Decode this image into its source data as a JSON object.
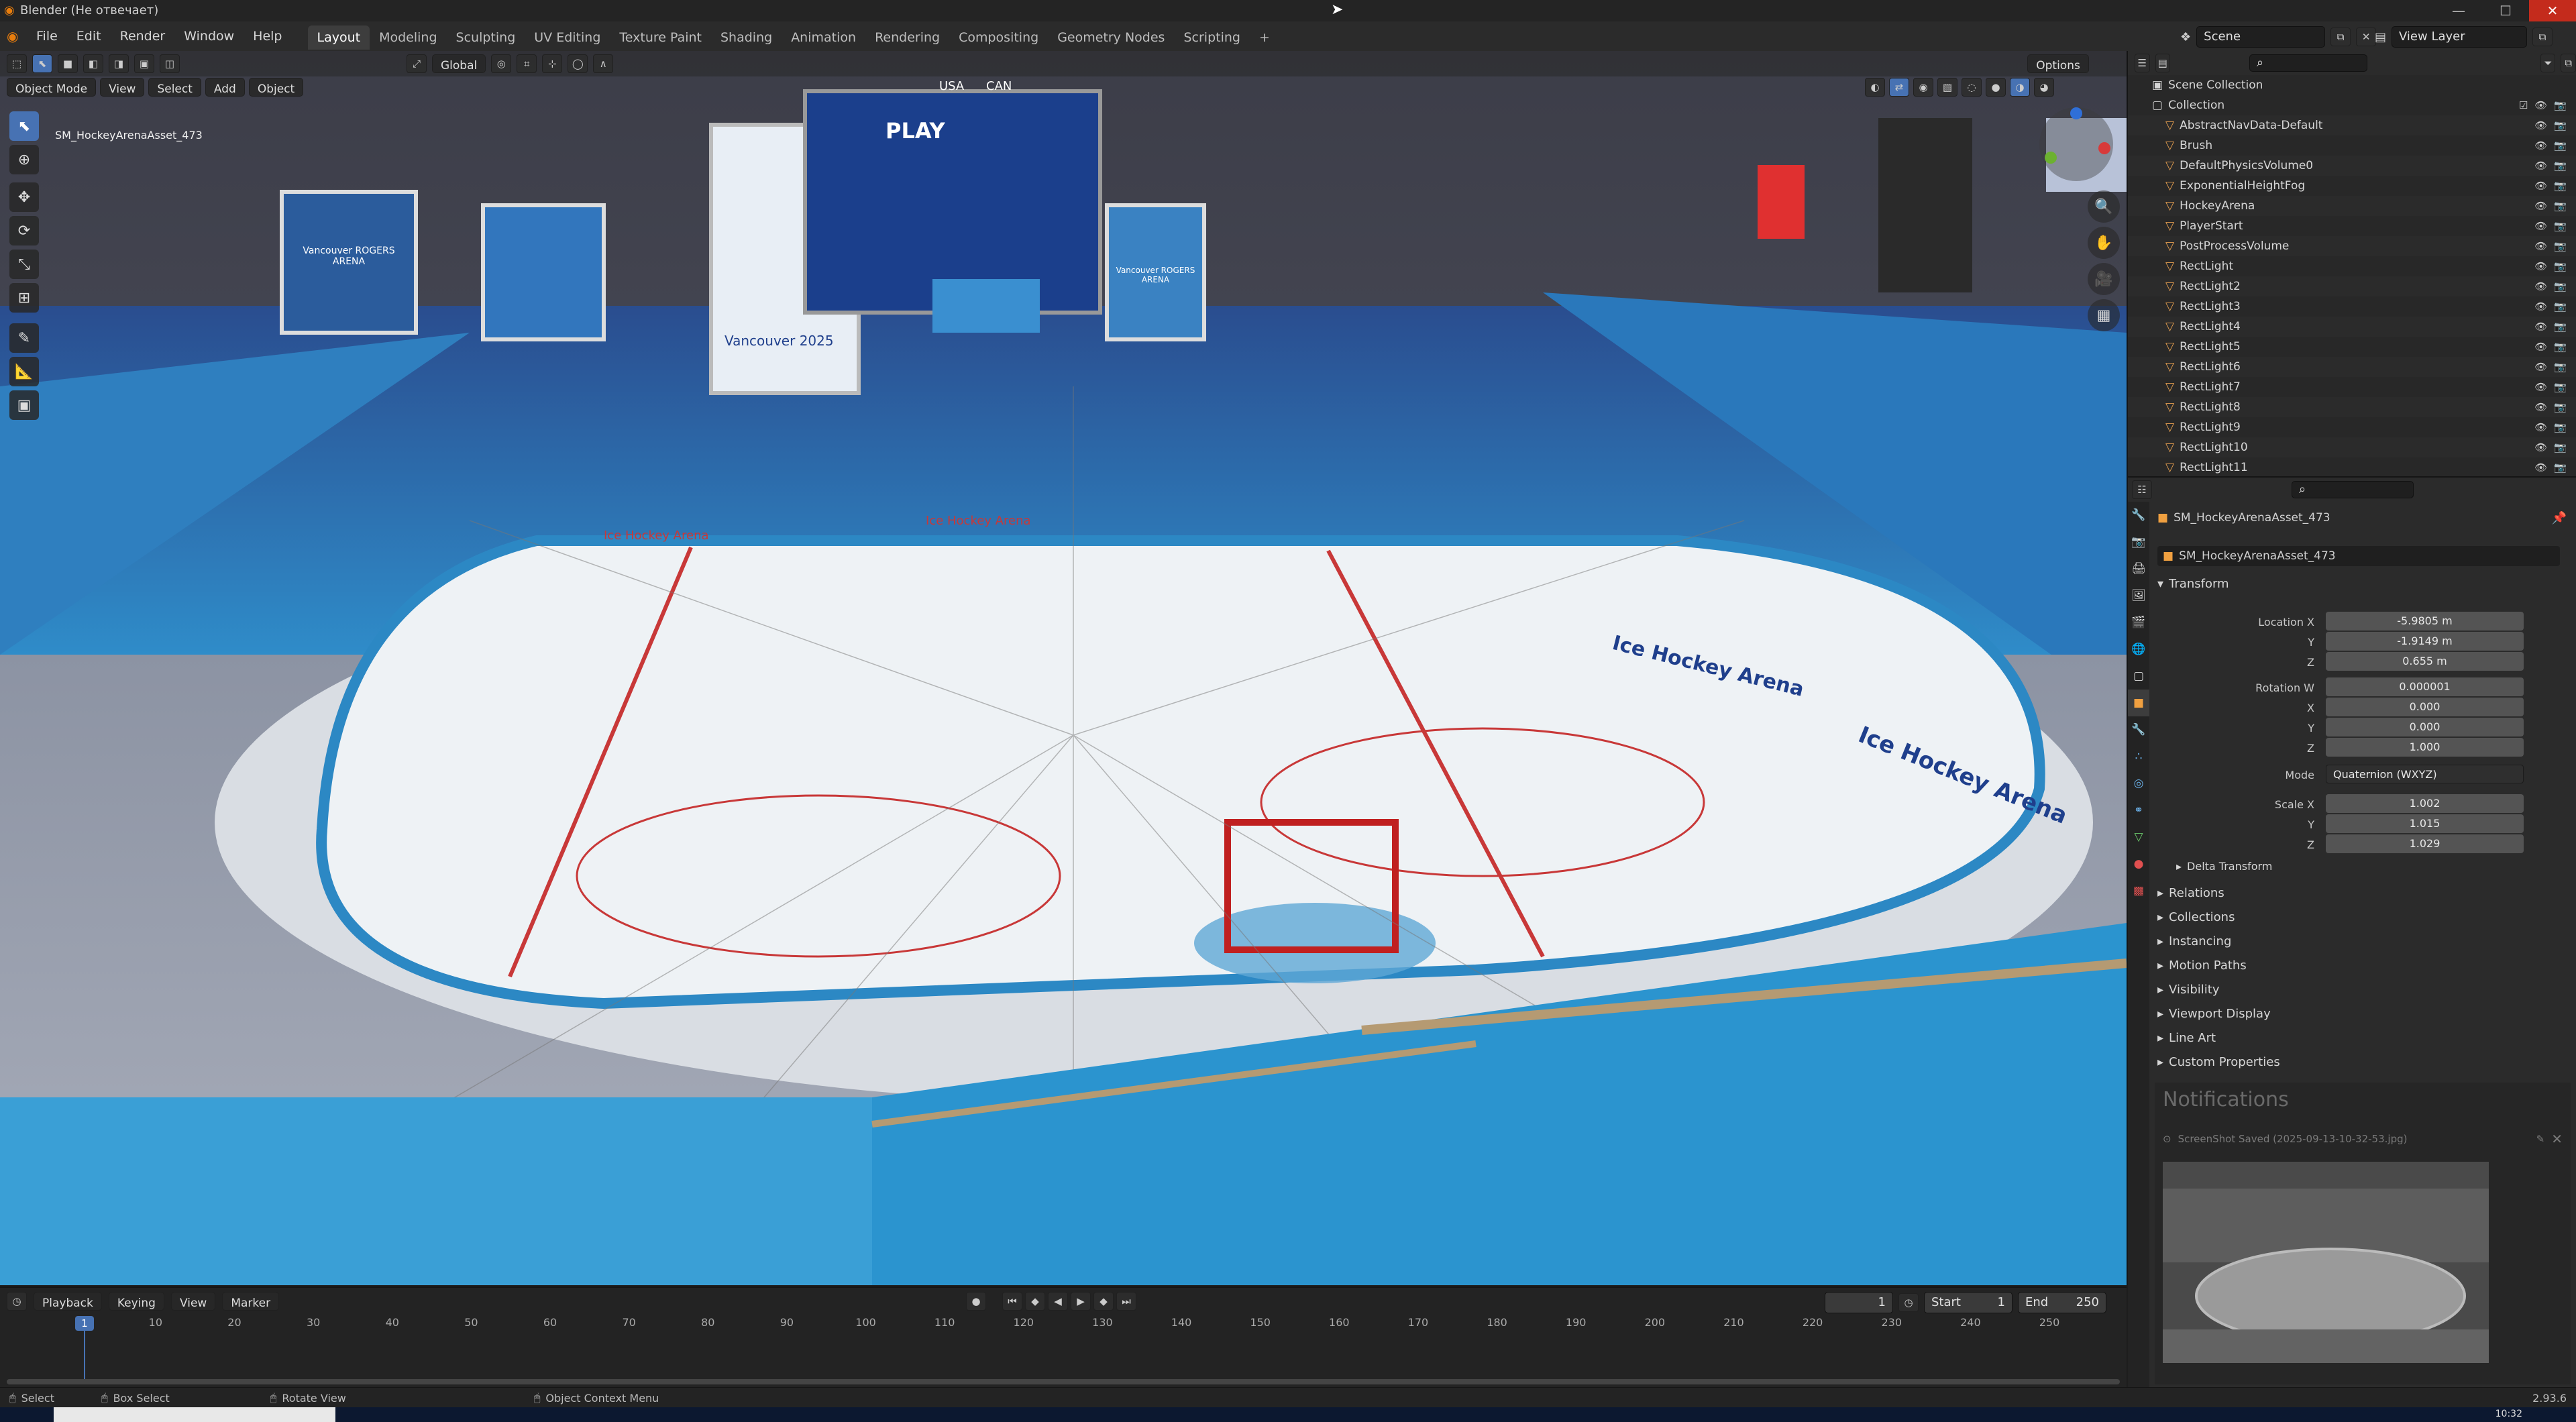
{
  "window": {
    "title": "Blender (Не отвечает)",
    "controls": [
      "—",
      "☐",
      "✕"
    ]
  },
  "menu": {
    "items": [
      "File",
      "Edit",
      "Render",
      "Window",
      "Help"
    ],
    "workspaces": [
      "Layout",
      "Modeling",
      "Sculpting",
      "UV Editing",
      "Texture Paint",
      "Shading",
      "Animation",
      "Rendering",
      "Compositing",
      "Geometry Nodes",
      "Scripting"
    ],
    "add_tab": "+",
    "scene": "Scene",
    "view_layer": "View Layer"
  },
  "viewport": {
    "mode": "Object Mode",
    "menus": [
      "View",
      "Select",
      "Add",
      "Object"
    ],
    "orientation": "Global",
    "options": "Options",
    "overlay_text": "SM_HockeyArenaAsset_473",
    "scene_texts": {
      "board_left": "Vancouver ROGERS ARENA",
      "board_mid": "Vancouver 2025",
      "scoreboard_usa": "USA",
      "scoreboard_can": "CAN",
      "scoreboard_play": "PLAY",
      "board_right": "Vancouver ROGERS ARENA",
      "rink_text_1": "Ice Hockey Arena",
      "rink_text_2": "Ice Hockey Arena",
      "rink_text_3": "Ice Hockey Arena",
      "rink_text_4": "Ice Hockey Arena"
    },
    "colors": {
      "seat_blue": "#2b8bc6",
      "seat_dark": "#1f3f8c",
      "rink_red": "#c83838",
      "ice": "#e8edf1"
    }
  },
  "timeline": {
    "menus": [
      "Playback",
      "Keying",
      "View",
      "Marker"
    ],
    "current_frame": "1",
    "start_label": "Start",
    "start": "1",
    "end_label": "End",
    "end": "250",
    "ticks": [
      "1",
      "10",
      "20",
      "30",
      "40",
      "50",
      "60",
      "70",
      "80",
      "90",
      "100",
      "110",
      "120",
      "130",
      "140",
      "150",
      "160",
      "170",
      "180",
      "190",
      "200",
      "210",
      "220",
      "230",
      "240",
      "250"
    ]
  },
  "statusbar": {
    "select": "Select",
    "box_select": "Box Select",
    "rotate_view": "Rotate View",
    "context_menu": "Object Context Menu",
    "version": "2.93.6",
    "clock": "10:32"
  },
  "outliner": {
    "root": "Scene Collection",
    "items": [
      {
        "label": "Collection",
        "depth": 1
      },
      {
        "label": "AbstractNavData-Default",
        "depth": 2
      },
      {
        "label": "Brush",
        "depth": 2
      },
      {
        "label": "DefaultPhysicsVolume0",
        "depth": 2
      },
      {
        "label": "ExponentialHeightFog",
        "depth": 2
      },
      {
        "label": "HockeyArena",
        "depth": 2
      },
      {
        "label": "PlayerStart",
        "depth": 2
      },
      {
        "label": "PostProcessVolume",
        "depth": 2
      },
      {
        "label": "RectLight",
        "depth": 2
      },
      {
        "label": "RectLight2",
        "depth": 2
      },
      {
        "label": "RectLight3",
        "depth": 2
      },
      {
        "label": "RectLight4",
        "depth": 2
      },
      {
        "label": "RectLight5",
        "depth": 2
      },
      {
        "label": "RectLight6",
        "depth": 2
      },
      {
        "label": "RectLight7",
        "depth": 2
      },
      {
        "label": "RectLight8",
        "depth": 2
      },
      {
        "label": "RectLight9",
        "depth": 2
      },
      {
        "label": "RectLight10",
        "depth": 2
      },
      {
        "label": "RectLight11",
        "depth": 2
      }
    ]
  },
  "properties": {
    "object_name": "SM_HockeyArenaAsset_473",
    "object_field": "SM_HockeyArenaAsset_473",
    "transform": {
      "header": "Transform",
      "location_label": "Location X",
      "location": [
        "-5.9805 m",
        "-1.9149 m",
        "0.655 m"
      ],
      "rotation_label": "Rotation W",
      "rotation": [
        "0.000001",
        "0.000",
        "0.000",
        "1.000"
      ],
      "mode_label": "Mode",
      "mode": "Quaternion (WXYZ)",
      "scale_label": "Scale X",
      "scale": [
        "1.002",
        "1.015",
        "1.029"
      ],
      "axis_labels": [
        "Y",
        "Z",
        "X",
        "Y",
        "Z",
        "Y",
        "Z"
      ]
    },
    "delta_transform": "Delta Transform",
    "panels": [
      "Relations",
      "Collections",
      "Instancing",
      "Motion Paths",
      "Visibility",
      "Viewport Display",
      "Line Art",
      "Custom Properties"
    ]
  },
  "notifications": {
    "header": "Notifications",
    "message": "ScreenShot Saved   (2025-09-13-10-32-53.jpg)"
  }
}
